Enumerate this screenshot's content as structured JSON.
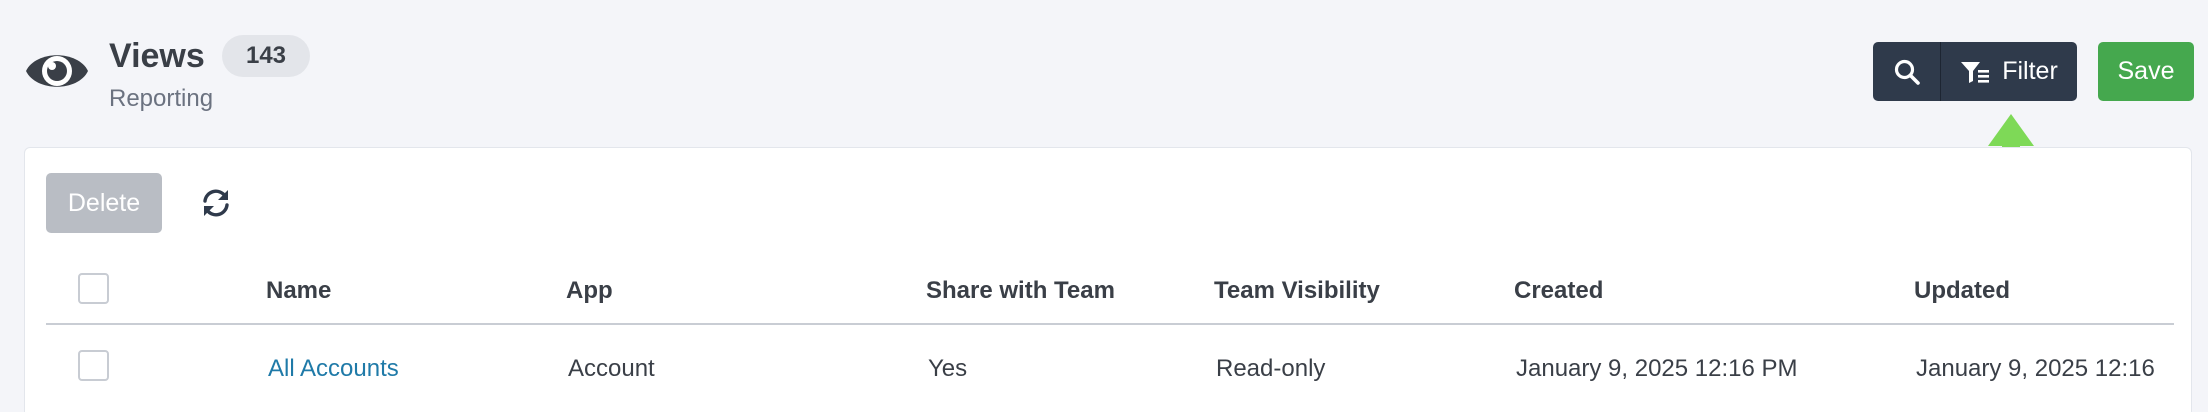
{
  "header": {
    "title": "Views",
    "count": "143",
    "subtitle": "Reporting",
    "icon": "eye-icon"
  },
  "toolbar": {
    "search_icon": "search-icon",
    "filter_label": "Filter",
    "filter_icon": "filter-icon",
    "save_label": "Save"
  },
  "card_toolbar": {
    "delete_label": "Delete",
    "refresh_icon": "refresh-icon"
  },
  "table": {
    "columns": [
      "Name",
      "App",
      "Share with Team",
      "Team Visibility",
      "Created",
      "Updated"
    ],
    "rows": [
      {
        "name": "All Accounts",
        "app": "Account",
        "share": "Yes",
        "visibility": "Read-only",
        "created": "January 9, 2025 12:16 PM",
        "updated": "January 9, 2025 12:16"
      }
    ]
  },
  "colors": {
    "accent_dark": "#2f3a4b",
    "save_green": "#45a84e",
    "link_blue": "#1f7aa8",
    "annotation_arrow": "#7ed957"
  }
}
